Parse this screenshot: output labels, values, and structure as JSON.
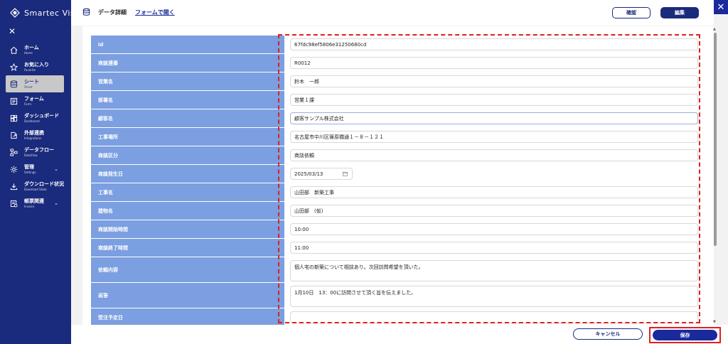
{
  "app": {
    "brand": "Smartec Visi"
  },
  "sidebar": {
    "items": [
      {
        "label": "ホーム",
        "sub": "Home",
        "icon": "home-icon"
      },
      {
        "label": "お気に入り",
        "sub": "Favorite",
        "icon": "star-icon"
      },
      {
        "label": "シート",
        "sub": "Sheet",
        "icon": "database-icon",
        "active": true
      },
      {
        "label": "フォーム",
        "sub": "Form",
        "icon": "form-icon"
      },
      {
        "label": "ダッシュボード",
        "sub": "Dashboard",
        "icon": "dashboard-icon"
      },
      {
        "label": "外部連携",
        "sub": "Integrations",
        "icon": "external-link-icon"
      },
      {
        "label": "データフロー",
        "sub": "DataFlow",
        "icon": "dataflow-icon"
      },
      {
        "label": "管理",
        "sub": "Settings",
        "icon": "gear-icon",
        "caret": true
      },
      {
        "label": "ダウンロード状況",
        "sub": "Download State",
        "icon": "download-icon"
      },
      {
        "label": "帳票関連",
        "sub": "Invoice",
        "icon": "report-icon",
        "caret": true
      }
    ]
  },
  "header": {
    "title": "データ詳細",
    "open_form_link": "フォームで開く",
    "confirm_label": "確認",
    "edit_label": "編集"
  },
  "fields": [
    {
      "label": "id",
      "value": "67fdc98ef5806e31250680cd"
    },
    {
      "label": "商談連番",
      "value": "R0012"
    },
    {
      "label": "営業名",
      "value": "鈴木　一郎"
    },
    {
      "label": "部署名",
      "value": "営業１課"
    },
    {
      "label": "顧客名",
      "value": "顧客サンプル株式会社"
    },
    {
      "label": "工事場所",
      "value": "名古屋市中川区篠原橋通１－８－１２１"
    },
    {
      "label": "商談区分",
      "value": "商談依頼"
    },
    {
      "label": "商談発生日",
      "value": "2025/03/13"
    },
    {
      "label": "工事名",
      "value": "山田部　新築工事"
    },
    {
      "label": "建物名",
      "value": "山田部　(仮)"
    },
    {
      "label": "商談開始時間",
      "value": "10:00"
    },
    {
      "label": "商談終了時間",
      "value": "11:00"
    },
    {
      "label": "依頼内容",
      "value": "個人宅の新築について相談あり。次回訪問希望を頂いた。"
    },
    {
      "label": "返答",
      "value": "1月10日　13：00に訪問させて頂く旨を伝えました。"
    },
    {
      "label": "受注予定日",
      "value": ""
    }
  ],
  "footer": {
    "cancel_label": "キャンセル",
    "save_label": "保存"
  },
  "colors": {
    "sidebar_bg": "#1a2a7c",
    "label_bg": "#7b9fe0",
    "primary": "#1a2a9c",
    "highlight": "#e02020"
  }
}
